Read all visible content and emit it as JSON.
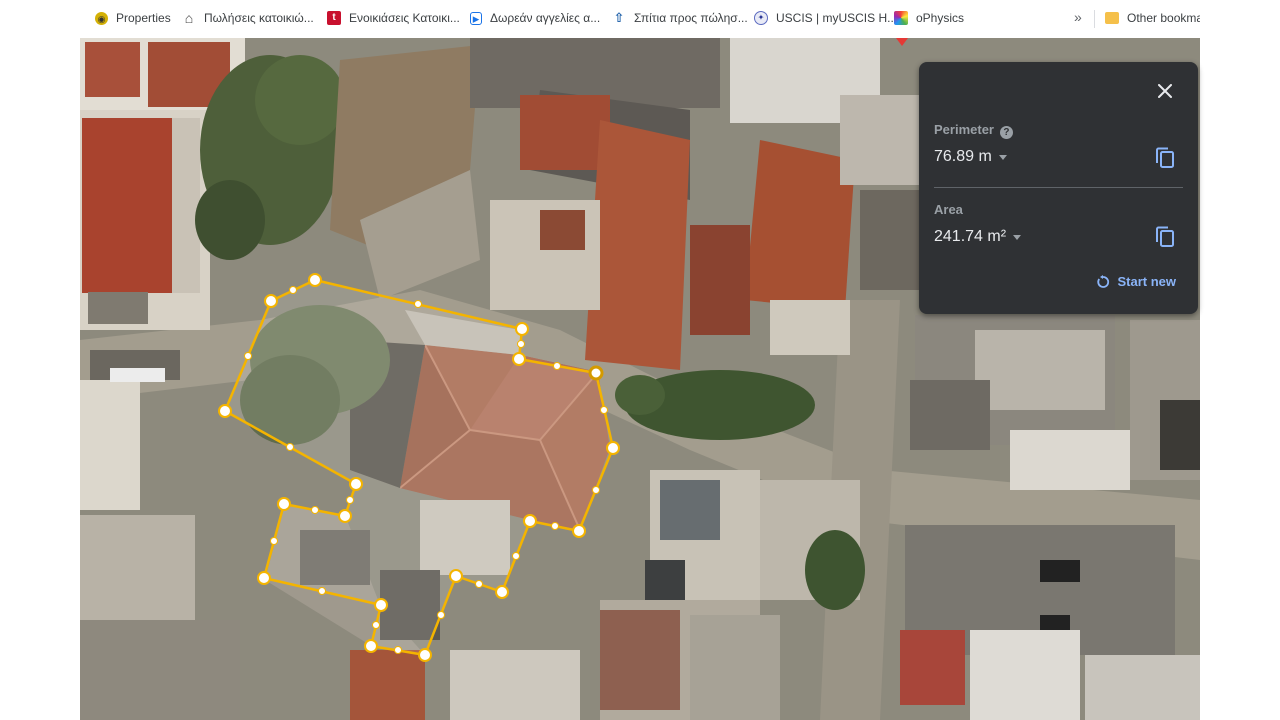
{
  "bookmarks": [
    {
      "label": "Properties",
      "icon": "properties-icon"
    },
    {
      "label": "Πωλήσεις κατοικιώ...",
      "icon": "house-icon"
    },
    {
      "label": "Ενοικιάσεις Κατοικι...",
      "icon": "t-logo-icon"
    },
    {
      "label": "Δωρεάν αγγελίες α...",
      "icon": "map-marker-icon"
    },
    {
      "label": "Σπίτια προς πώλησ...",
      "icon": "arrow-up-home-icon"
    },
    {
      "label": "USCIS | myUSCIS H...",
      "icon": "uscis-seal-icon"
    },
    {
      "label": "oPhysics",
      "icon": "ophysics-icon"
    }
  ],
  "bookmarks_more": "»",
  "other_bookmarks": "Other bookmarks",
  "measure": {
    "perimeter_label": "Perimeter",
    "perimeter_value": "76.89 m",
    "area_label": "Area",
    "area_value": "241.74 m²",
    "start_new_label": "Start new",
    "help_glyph": "?"
  },
  "colors": {
    "measure_line": "#f4b400",
    "panel_bg": "#2f3134",
    "link_blue": "#8ab4f8"
  }
}
